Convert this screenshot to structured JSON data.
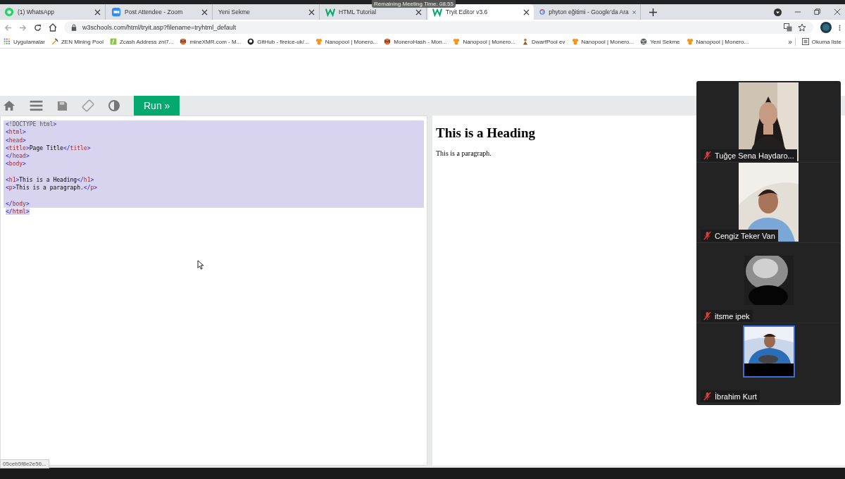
{
  "meeting_timer": "Remaining Meeting Time: 08:55",
  "tabs": [
    {
      "title": "(1) WhatsApp",
      "selected": false
    },
    {
      "title": "Post Attendee - Zoom",
      "selected": false
    },
    {
      "title": "Yeni Sekme",
      "selected": false
    },
    {
      "title": "HTML Tutorial",
      "selected": false
    },
    {
      "title": "Tryit Editor v3.6",
      "selected": true
    },
    {
      "title": "phyton eğitimi - Google'da Ara",
      "selected": false
    }
  ],
  "address": "w3schools.com/html/tryit.asp?filename=tryhtml_default",
  "bookmarks": [
    {
      "label": "Uygulamalar"
    },
    {
      "label": "ZEN Mining Pool"
    },
    {
      "label": "Zcash Address zni7..."
    },
    {
      "label": "mineXMR.com - M..."
    },
    {
      "label": "GitHub - fireice-uk/..."
    },
    {
      "label": "Nanopool | Monero..."
    },
    {
      "label": "MoneroHash - Mon..."
    },
    {
      "label": "Nanopool | Monero..."
    },
    {
      "label": "DwarfPool ev"
    },
    {
      "label": "Nanopool | Monero..."
    },
    {
      "label": "Yeni Sekme"
    },
    {
      "label": "Nanopool | Monero..."
    }
  ],
  "bookmarks_more": "»",
  "reading_list": "Okuma liste",
  "run_button": "Run »",
  "code_lines": [
    {
      "text": "<!DOCTYPE html>",
      "selected": true
    },
    {
      "text": "<html>",
      "selected": true
    },
    {
      "text": "<head>",
      "selected": true
    },
    {
      "text": "<title>Page Title</title>",
      "selected": true
    },
    {
      "text": "</head>",
      "selected": true
    },
    {
      "text": "<body>",
      "selected": true
    },
    {
      "selected": true
    },
    {
      "text": "<h1>This is a Heading</h1>",
      "selected": true
    },
    {
      "text": "<p>This is a paragraph.</p>",
      "selected": true
    },
    {
      "selected": true
    },
    {
      "text": "</body>",
      "selected": true
    },
    {
      "text": "</html>",
      "selected": true
    }
  ],
  "result": {
    "heading": "This is a Heading",
    "paragraph": "This is a paragraph."
  },
  "status_url": "05ceb5f8e2e56...",
  "participants": [
    {
      "name": "Tuğçe Sena Haydaro...",
      "muted": true,
      "highlighted": false
    },
    {
      "name": "Cengiz Teker Van",
      "muted": true,
      "highlighted": false
    },
    {
      "name": "itsme ipek",
      "muted": true,
      "highlighted": false
    },
    {
      "name": "İbrahim Kurt",
      "muted": true,
      "highlighted": true
    }
  ]
}
